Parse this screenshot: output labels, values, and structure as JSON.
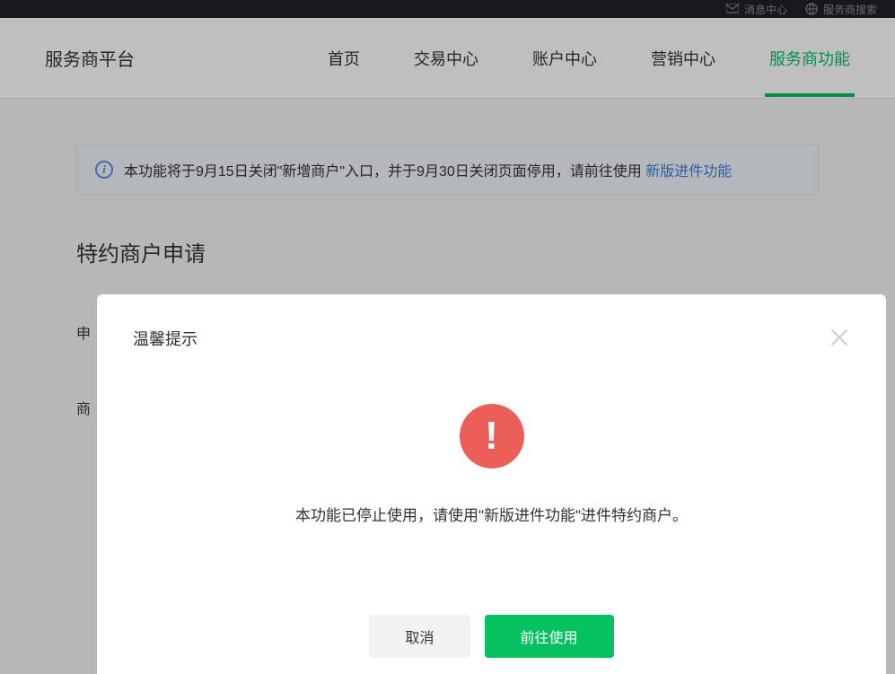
{
  "topbar": {
    "messages": "消息中心",
    "search": "服务商搜索"
  },
  "brand": "服务商平台",
  "nav": {
    "items": [
      {
        "label": "首页"
      },
      {
        "label": "交易中心"
      },
      {
        "label": "账户中心"
      },
      {
        "label": "营销中心"
      },
      {
        "label": "服务商功能"
      }
    ],
    "active_index": 4
  },
  "notice": {
    "text": "本功能将于9月15日关闭\"新增商户\"入口，并于9月30日关闭页面停用，请前往使用 ",
    "link_text": "新版进件功能"
  },
  "page_title": "特约商户申请",
  "form": {
    "row1_label": "申",
    "row2_label": "商"
  },
  "modal": {
    "title": "温馨提示",
    "message": "本功能已停止使用，请使用\"新版进件功能\"进件特约商户。",
    "cancel_label": "取消",
    "confirm_label": "前往使用"
  }
}
